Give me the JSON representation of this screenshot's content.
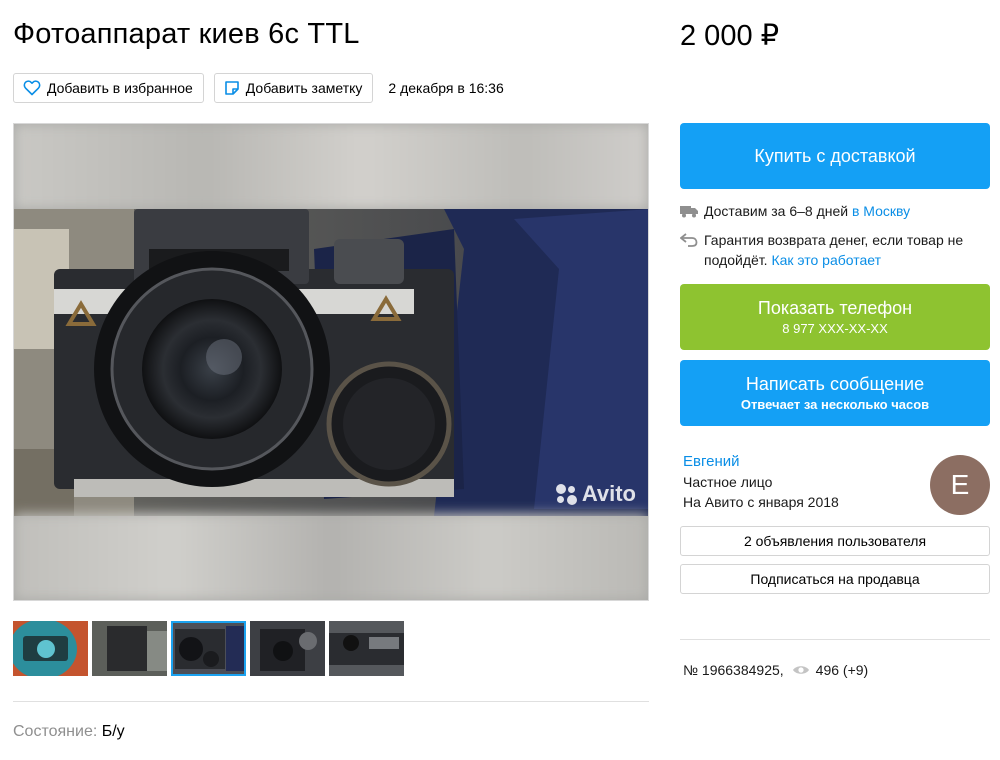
{
  "listing": {
    "title": "Фотоаппарат киев 6с TTL",
    "price": "2 000 ₽",
    "date": "2 декабря в 16:36",
    "condition_key": "Состояние:",
    "condition_value": "Б/у",
    "number": "№ 1966384925,",
    "views": "496 (+9)"
  },
  "toolbar": {
    "favorite_label": "Добавить в избранное",
    "note_label": "Добавить заметку"
  },
  "gallery": {
    "watermark": "Avito",
    "thumbnails_count": 5,
    "active_thumbnail": 3
  },
  "actions": {
    "buy_label": "Купить с доставкой",
    "delivery_text": "Доставим за 6–8 дней",
    "delivery_city": "в Москву",
    "guarantee_text": "Гарантия возврата денег, если товар не подойдёт.",
    "guarantee_link": "Как это работает",
    "phone_label": "Показать телефон",
    "phone_number": "8 977 XXX-XX-XX",
    "message_label": "Написать сообщение",
    "message_sub": "Отвечает за несколько часов"
  },
  "seller": {
    "name": "Евгений",
    "type": "Частное лицо",
    "since": "На Авито с января 2018",
    "avatar_letter": "Е",
    "listings_label": "2 объявления пользователя",
    "subscribe_label": "Подписаться на продавца"
  },
  "colors": {
    "accent_blue": "#14a0f5",
    "accent_green": "#8ec330",
    "link_blue": "#0a8ee6",
    "avatar": "#8c6e62"
  }
}
